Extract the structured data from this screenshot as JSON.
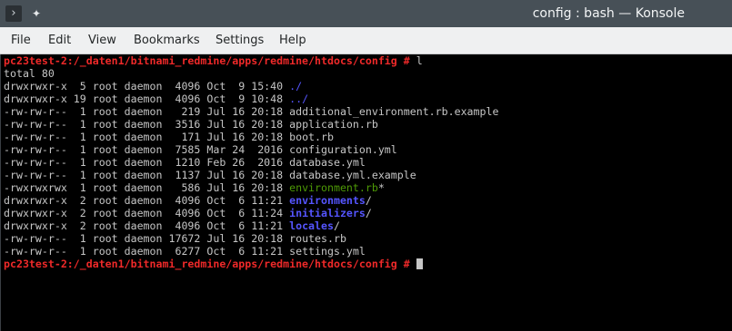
{
  "window": {
    "title": "config : bash — Konsole"
  },
  "icons": {
    "app": "terminal-app-icon",
    "pin": "pin-icon"
  },
  "menu": [
    {
      "label": "File"
    },
    {
      "label": "Edit"
    },
    {
      "label": "View"
    },
    {
      "label": "Bookmarks"
    },
    {
      "label": "Settings"
    },
    {
      "label": "Help"
    }
  ],
  "terminal": {
    "prompt": "pc23test-2:/_daten1/bitnami_redmine/apps/redmine/htdocs/config #",
    "command": " l",
    "total": "total 80",
    "entries": [
      {
        "meta": "drwxrwxr-x  5 root daemon  4096 Oct  9 15:40 ",
        "name": "./",
        "suffix": ""
      },
      {
        "meta": "drwxrwxr-x 19 root daemon  4096 Oct  9 10:48 ",
        "name": "../",
        "suffix": ""
      },
      {
        "meta": "-rw-rw-r--  1 root daemon   219 Jul 16 20:18 ",
        "name": "additional_environment.rb.example",
        "suffix": ""
      },
      {
        "meta": "-rw-rw-r--  1 root daemon  3516 Jul 16 20:18 ",
        "name": "application.rb",
        "suffix": ""
      },
      {
        "meta": "-rw-rw-r--  1 root daemon   171 Jul 16 20:18 ",
        "name": "boot.rb",
        "suffix": ""
      },
      {
        "meta": "-rw-rw-r--  1 root daemon  7585 Mar 24  2016 ",
        "name": "configuration.yml",
        "suffix": ""
      },
      {
        "meta": "-rw-rw-r--  1 root daemon  1210 Feb 26  2016 ",
        "name": "database.yml",
        "suffix": ""
      },
      {
        "meta": "-rw-rw-r--  1 root daemon  1137 Jul 16 20:18 ",
        "name": "database.yml.example",
        "suffix": ""
      },
      {
        "meta": "-rwxrwxrwx  1 root daemon   586 Jul 16 20:18 ",
        "name": "environment.rb",
        "suffix": "*"
      },
      {
        "meta": "drwxrwxr-x  2 root daemon  4096 Oct  6 11:21 ",
        "name": "environments",
        "suffix": "/"
      },
      {
        "meta": "drwxrwxr-x  2 root daemon  4096 Oct  6 11:24 ",
        "name": "initializers",
        "suffix": "/"
      },
      {
        "meta": "drwxrwxr-x  2 root daemon  4096 Oct  6 11:21 ",
        "name": "locales",
        "suffix": "/"
      },
      {
        "meta": "-rw-rw-r--  1 root daemon 17672 Jul 16 20:18 ",
        "name": "routes.rb",
        "suffix": ""
      },
      {
        "meta": "-rw-rw-r--  1 root daemon  6277 Oct  6 11:21 ",
        "name": "settings.yml",
        "suffix": ""
      }
    ],
    "entry_styles": [
      "dot",
      "dot",
      "",
      "",
      "",
      "",
      "",
      "",
      "exec",
      "dir",
      "dir",
      "dir",
      "",
      ""
    ],
    "next_command": " "
  },
  "colors": {
    "prompt": "#ef2929",
    "directory": "#5555ff",
    "executable": "#4e9a06",
    "dotdir": "#5555ff"
  }
}
